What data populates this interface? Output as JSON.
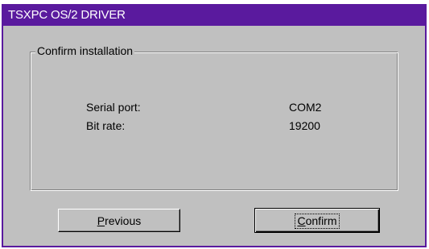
{
  "window": {
    "title": "TSXPC OS/2 DRIVER"
  },
  "group": {
    "legend": "Confirm installation"
  },
  "fields": [
    {
      "label": "Serial port:",
      "value": "COM2"
    },
    {
      "label": "Bit rate:",
      "value": "19200"
    }
  ],
  "buttons": {
    "previous": {
      "accel": "P",
      "rest": "revious"
    },
    "confirm": {
      "accel": "C",
      "rest": "onfirm",
      "is_default": true
    }
  },
  "colors": {
    "titlebar": "#5a1a9e",
    "face": "#c0c0c0",
    "title_text": "#ffffff"
  }
}
